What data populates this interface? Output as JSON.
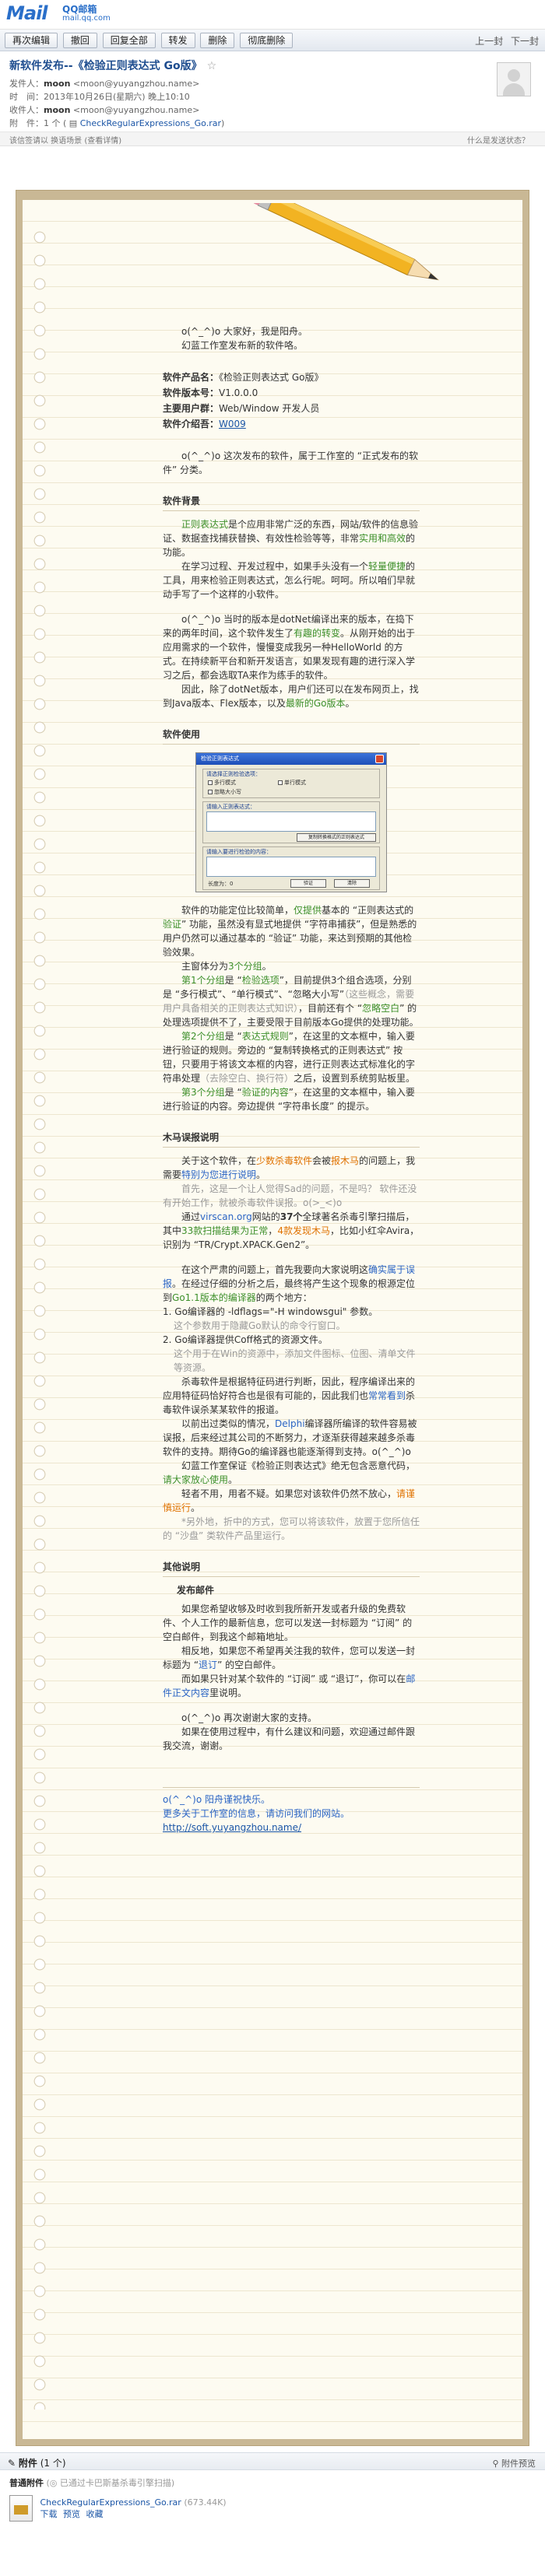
{
  "brand": {
    "logo": "Mail",
    "name": "QQ邮箱",
    "domain": "mail.qq.com"
  },
  "toolbar": {
    "buttons": [
      "再次编辑",
      "撤回",
      "回复全部",
      "转发",
      "删除",
      "彻底删除"
    ],
    "nav": [
      "上一封",
      "下一封"
    ]
  },
  "mail": {
    "subject": "新软件发布--《检验正则表达式 Go版》",
    "sender_label": "发件人：",
    "sender": "moon",
    "sender_email": "<moon@yuyangzhou.name>",
    "time_label": "时　间：",
    "time": "2013年10月26日(星期六) 晚上10:10",
    "to_label": "收件人：",
    "to": "moon",
    "to_email": "<moon@yuyangzhou.name>",
    "attach_label": "附　件：",
    "attach_count": "1 个 (",
    "attach_file": "CheckRegularExpressions_Go.rar",
    "attach_close": ")"
  },
  "infobar": {
    "left": "该信签请以 换语场景 (查看详情)",
    "right": "什么是发送状态？"
  },
  "letter": {
    "greeting": "o(^_^)o 大家好，我是阳舟。",
    "intro": "幻蓝工作室发布新的软件咯。",
    "product_name_label": "软件产品名：",
    "product_name": "《检验正则表达式 Go版》",
    "version_label": "软件版本号：",
    "version": "V1.0.0.0",
    "users_label": "主要用户群：",
    "users": "Web/Window 开发人员",
    "intro_no_label": "软件介绍吾：",
    "intro_no": "W009",
    "note": "o(^_^)o 这次发布的软件，属于工作室的 “正式发布的软件” 分类。",
    "bg_title": "软件背景",
    "bg_p1_a": "正则表达式",
    "bg_p1_b": "是个应用非常广泛的东西，网站/软件的信息验证、数据查找捕获替换、有效性检验等等，非常",
    "bg_p1_c": "实用和高效",
    "bg_p1_d": "的功能。",
    "bg_p2_a": "在学习过程、开发过程中，如果手头没有一个",
    "bg_p2_b": "轻量便捷",
    "bg_p2_c": "的工具，用来检验正则表达式，怎么行呢。呵呵。所以咱们早就动手写了一个这样的小软件。",
    "bg_p3_a": "o(^_^)o 当时的版本是dotNet编译出来的版本，在捣下来的两年时间，这个软件发生了",
    "bg_p3_b": "有趣的转变",
    "bg_p3_c": "。从刚开始的出于应用需求的一个软件，慢慢变成我另一种HelloWorld 的方式。在持续新平台和新开发语言，如果发现有趣的进行深入学习之后，都会选取TA来作为练手的软件。",
    "bg_p4_a": "因此，除了dotNet版本，用户们还可以在发布网页上，找到Java版本、Flex版本，以及",
    "bg_p4_b": "最新的Go版本",
    "bg_p4_c": "。",
    "use_title": "软件使用",
    "shot": {
      "title": "检验正则表达式",
      "options_label": "请选择正则检验选项：",
      "opt1": "多行模式",
      "opt2": "单行模式",
      "opt3": "忽略大小写",
      "regex_label": "请输入正则表达式：",
      "copy_btn": "复制转换格式的正则表达式",
      "text_label": "请输入要进行检验的内容：",
      "len_label": "长度为：0",
      "verify_btn": "验证",
      "clear_btn": "清除"
    },
    "use_p1_a": "软件的功能定位比较简单，",
    "use_p1_b": "仅提供",
    "use_p1_c": "基本的 “正则表达式的",
    "use_p1_d": "验证",
    "use_p1_e": "” 功能，虽然没有显式地提供 “字符串捕获”，但是熟悉的用户仍然可以通过基本的 “验证” 功能，来达到预期的其他检验效果。",
    "use_p2_a": "主窗体分为",
    "use_p2_b": "3个分组",
    "use_p2_c": "。",
    "use_p3_a": "第1个分组",
    "use_p3_b": "是 “",
    "use_p3_c": "检验选项",
    "use_p3_d": "”，目前提供3个组合选项，分别是 “多行模式”、“单行模式”、“忽略大小写”",
    "use_p3_e": "（这些概念，需要用户具备相关的正则表达式知识）",
    "use_p3_f": "，目前还有个 “",
    "use_p3_g": "忽略空白",
    "use_p3_h": "” 的处理选项提供不了，主要受限于目前版本Go提供的处理功能。",
    "use_p4_a": "第2个分组",
    "use_p4_b": "是 “",
    "use_p4_c": "表达式规则",
    "use_p4_d": "”，在这里的文本框中，输入要进行验证的规则。旁边的 “复制转换格式的正则表达式” 按钮，只要用于将该文本框的内容，进行正则表达式标准化的字符串处理",
    "use_p4_e": "（去除空白、换行符）",
    "use_p4_f": "之后，设置到系统剪贴板里。",
    "use_p5_a": "第3个分组",
    "use_p5_b": "是 “",
    "use_p5_c": "验证的内容",
    "use_p5_d": "”，在这里的文本框中，输入要进行验证的内容。旁边提供 “字符串长度” 的提示。",
    "trojan_title": "木马误报说明",
    "tr_p1_a": "关于这个软件，在",
    "tr_p1_b": "少数杀毒软件",
    "tr_p1_c": "会被",
    "tr_p1_d": "报木马",
    "tr_p1_e": "的问题上，我需要",
    "tr_p1_f": "特别为您进行说明",
    "tr_p1_g": "。",
    "tr_p2": "首先，这是一个让人觉得Sad的问题，不是吗？ 软件还没有开始工作，就被杀毒软件误报。o(>_<)o",
    "tr_p3_a": "通过",
    "tr_p3_b": "virscan.org",
    "tr_p3_c": "网站的",
    "tr_p3_d": "37个",
    "tr_p3_e": "全球著名杀毒引擎扫描后，其中",
    "tr_p3_f": "33款扫描结果为正常",
    "tr_p3_g": "，",
    "tr_p3_h": "4款发现木马",
    "tr_p3_i": "，比如小红伞Avira，识别为 “TR/Crypt.XPACK.Gen2”。",
    "tr_p4_a": "在这个严肃的问题上，首先我要向大家说明这",
    "tr_p4_b": "确实属于误报",
    "tr_p4_c": "。在经过仔细的分析之后，最终将产生这个现象的根源定位到",
    "tr_p4_d": "Go1.1版本的编译器",
    "tr_p4_e": "的两个地方：",
    "tr_l1": "1. Go编译器的 -ldflags=\"-H windowsgui\" 参数。",
    "tr_l1_note": "这个参数用于隐藏Go默认的命令行窗口。",
    "tr_l2": "2. Go编译器提供Coff格式的资源文件。",
    "tr_l2_note": "这个用于在Win的资源中，添加文件图标、位图、清单文件等资源。",
    "tr_p5_a": "杀毒软件是根据特征码进行判断，因此，程序编译出来的应用特征码恰好符合也是很有可能的，因此我们也",
    "tr_p5_b": "常常看到",
    "tr_p5_c": "杀毒软件误杀某某软件的报道。",
    "tr_p6_a": "以前出过类似的情况，",
    "tr_p6_b": "Delphi",
    "tr_p6_c": "编译器所编译的软件容易被误报，后来经过其公司的不断努力，才逐渐获得越来越多杀毒软件的支持。期待Go的编译器也能逐渐得到支持。o(^_^)o",
    "tr_p7_a": "幻蓝工作室保证《检验正则表达式》绝无包含恶意代码，",
    "tr_p7_b": "请大家放心使用",
    "tr_p7_c": "。",
    "tr_p8_a": "轻者不用，用者不疑。如果您对该软件仍然不放心，",
    "tr_p8_b": "请谨慎运行",
    "tr_p8_c": "。",
    "tr_p9": "*另外地，折中的方式，您可以将该软件，放置于您所信任的 “沙盘” 类软件产品里运行。",
    "other_title": "其他说明",
    "sub_title": "发布邮件",
    "ot_p1": "如果您希望收够及时收到我所新开发或者升级的免费软件、个人工作的最新信息，您可以发送一封标题为 “订阅” 的空白邮件，到我这个邮箱地址。",
    "ot_p2_a": "相反地，如果您不希望再关注我的软件，您可以发送一封标题为 “",
    "ot_p2_b": "退订",
    "ot_p2_c": "” 的空白邮件。",
    "ot_p3_a": "而如果只针对某个软件的 “订阅” 或 “退订”，你可以在",
    "ot_p3_b": "邮件正文内容",
    "ot_p3_c": "里说明。",
    "ot_p4": "o(^_^)o 再次谢谢大家的支持。",
    "ot_p5": "如果在使用过程中，有什么建议和问题，欢迎通过邮件跟我交流，谢谢。",
    "sign_1": "o(^_^)o 阳舟谨祝快乐。",
    "sign_2": "更多关于工作室的信息，请访问我们的网站。",
    "sign_url": "http://soft.yuyangzhou.name/"
  },
  "attachments": {
    "head": "附件",
    "count": "(1 个)",
    "preview_all": "附件预览",
    "group_title": "普通附件",
    "group_sub": "(◎ 已通过卡巴斯基杀毒引擎扫描)",
    "file_name": "CheckRegularExpressions_Go.rar",
    "file_size": "(673.44K)",
    "actions": [
      "下载",
      "预览",
      "收藏"
    ]
  },
  "colors": {
    "accent": "#2a6fc9",
    "paper": "#fdfbf1",
    "frame": "#c9b895",
    "green": "#3c8f2a",
    "orange": "#e07200"
  }
}
